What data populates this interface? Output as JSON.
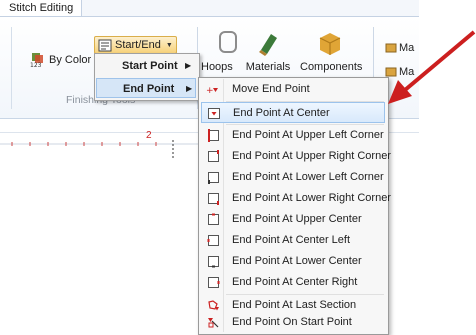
{
  "ribbon": {
    "tab_label": "Stitch Editing",
    "by_color_label": "By Color",
    "start_end_label": "Start/End",
    "group_label": "Finishing Tools",
    "hoops_label": "Hoops",
    "materials_label": "Materials",
    "components_label": "Components",
    "right_items": [
      "Ma",
      "Ma"
    ]
  },
  "ruler": {
    "mark": "2"
  },
  "submenu": {
    "items": [
      {
        "label": "Start Point",
        "has_submenu": true
      },
      {
        "label": "End Point",
        "has_submenu": true,
        "selected": true
      }
    ]
  },
  "dropdown": {
    "items": [
      {
        "label": "Move End Point",
        "icon": "move-end-point-icon"
      },
      {
        "label": "End Point At Center",
        "icon": "center-icon",
        "highlighted": true
      },
      {
        "label": "End Point At Upper Left Corner",
        "icon": "upper-left-icon"
      },
      {
        "label": "End Point At Upper Right Corner",
        "icon": "upper-right-icon"
      },
      {
        "label": "End Point At Lower Left Corner",
        "icon": "lower-left-icon"
      },
      {
        "label": "End Point At Lower Right Corner",
        "icon": "lower-right-icon"
      },
      {
        "label": "End Point At Upper Center",
        "icon": "upper-center-icon"
      },
      {
        "label": "End Point At Center Left",
        "icon": "center-left-icon"
      },
      {
        "label": "End Point At Lower Center",
        "icon": "lower-center-icon"
      },
      {
        "label": "End Point At Center Right",
        "icon": "center-right-icon"
      },
      {
        "label": "End Point At Last Section",
        "icon": "last-section-icon"
      },
      {
        "label": "End Point On Start Point",
        "icon": "on-start-point-icon"
      }
    ]
  },
  "colors": {
    "accent_red": "#cc1f1f",
    "highlight": "#d8e9fb",
    "ribbon_bg": "#f2f6fb"
  }
}
